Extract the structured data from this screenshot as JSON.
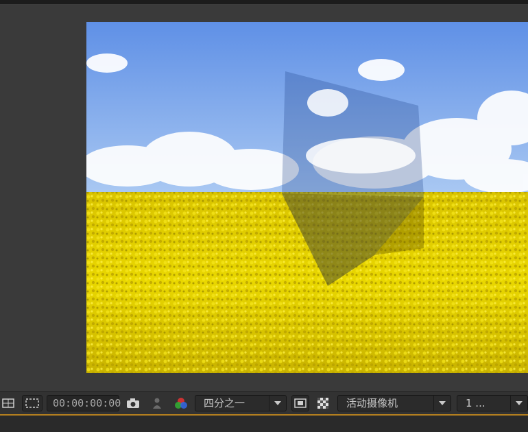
{
  "toolbar": {
    "timecode": "00:00:00:00",
    "resolution_value": "四分之一",
    "camera_value": "活动摄像机",
    "view_layout_value": "1 ..."
  },
  "icons": {
    "region_of_interest": "region-of-interest-icon",
    "transparency_grid": "transparency-grid-icon",
    "snapshot": "camera-icon",
    "show_snapshot": "person-icon",
    "channels": "rgb-channels-icon",
    "fast_preview": "fast-preview-icon",
    "checkerboard": "checkerboard-icon"
  },
  "colors": {
    "panel_bg": "#3a3a3a",
    "toolbar_bg": "#323232",
    "accent_line": "#b5801f",
    "sky": "#6f9ee8",
    "field": "#e6cf00"
  }
}
